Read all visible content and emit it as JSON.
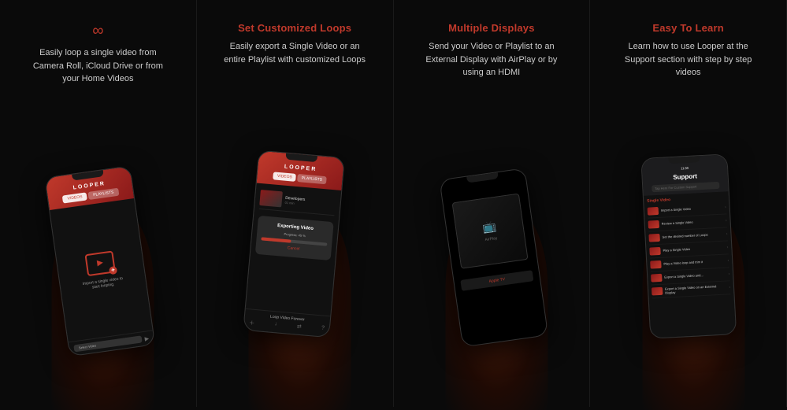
{
  "panels": [
    {
      "id": "panel1",
      "title": "∞",
      "title_text": "",
      "desc": "Easily loop a single video from Camera Roll, iCloud Drive or from your Home Videos",
      "screen": "looper_main"
    },
    {
      "id": "panel2",
      "title": "Set Customized Loops",
      "desc": "Easily export a Single Video or an entire Playlist with customized Loops",
      "screen": "export"
    },
    {
      "id": "panel3",
      "title": "Multiple Displays",
      "desc": "Send your Video or Playlist to an External Display with AirPlay or by using an HDMI",
      "screen": "airplay"
    },
    {
      "id": "panel4",
      "title": "Easy To Learn",
      "desc": "Learn how to use Looper at the Support section with step by step videos",
      "screen": "support"
    }
  ],
  "screen1": {
    "logo": "LOOPER",
    "tab_videos": "VIDEOS",
    "tab_playlists": "PLAYLISTS",
    "import_label": "Import a single video to\nstart looping.",
    "select_btn": "Select Video",
    "footer_icons": [
      "＋",
      "↓",
      "⇄",
      "?"
    ]
  },
  "screen2": {
    "logo": "LOOPER",
    "tab_videos": "VIDEOS",
    "tab_playlists": "PLAYLISTS",
    "video_title": "Developers",
    "video_duration": "01 min",
    "export_title": "Exporting Video",
    "export_sub": "Progress: 45 %",
    "cancel_btn": "Cancel",
    "loop_label": "Loop Video Forever",
    "footer_icons": [
      "＋",
      "↓",
      "⇄",
      "?"
    ]
  },
  "screen3": {
    "display_label": "Apple TV",
    "airplay_label": "AirPlay"
  },
  "screen4": {
    "header_title": "Support",
    "status_time": "11:30",
    "search_placeholder": "Tap Here For Custom Support",
    "section_single": "Single Video",
    "items": [
      {
        "icon": "▶",
        "text": "Import a Single Video"
      },
      {
        "icon": "▶",
        "text": "Review a Single Video"
      },
      {
        "icon": "▶",
        "text": "Set the desired number of Loops"
      },
      {
        "icon": "▶",
        "text": "Play a Single Video"
      },
      {
        "icon": "▶",
        "text": "Play a Video loop and trim it"
      },
      {
        "icon": "▶",
        "text": "Export a Single Video and..."
      },
      {
        "icon": "▶",
        "text": "Export a Single Video on an External Display"
      }
    ]
  },
  "colors": {
    "accent": "#c0392b",
    "dark_bg": "#0a0a0a",
    "phone_bg": "#1a1a1a",
    "text_primary": "#ffffff",
    "text_secondary": "#cccccc",
    "text_muted": "#999999"
  }
}
